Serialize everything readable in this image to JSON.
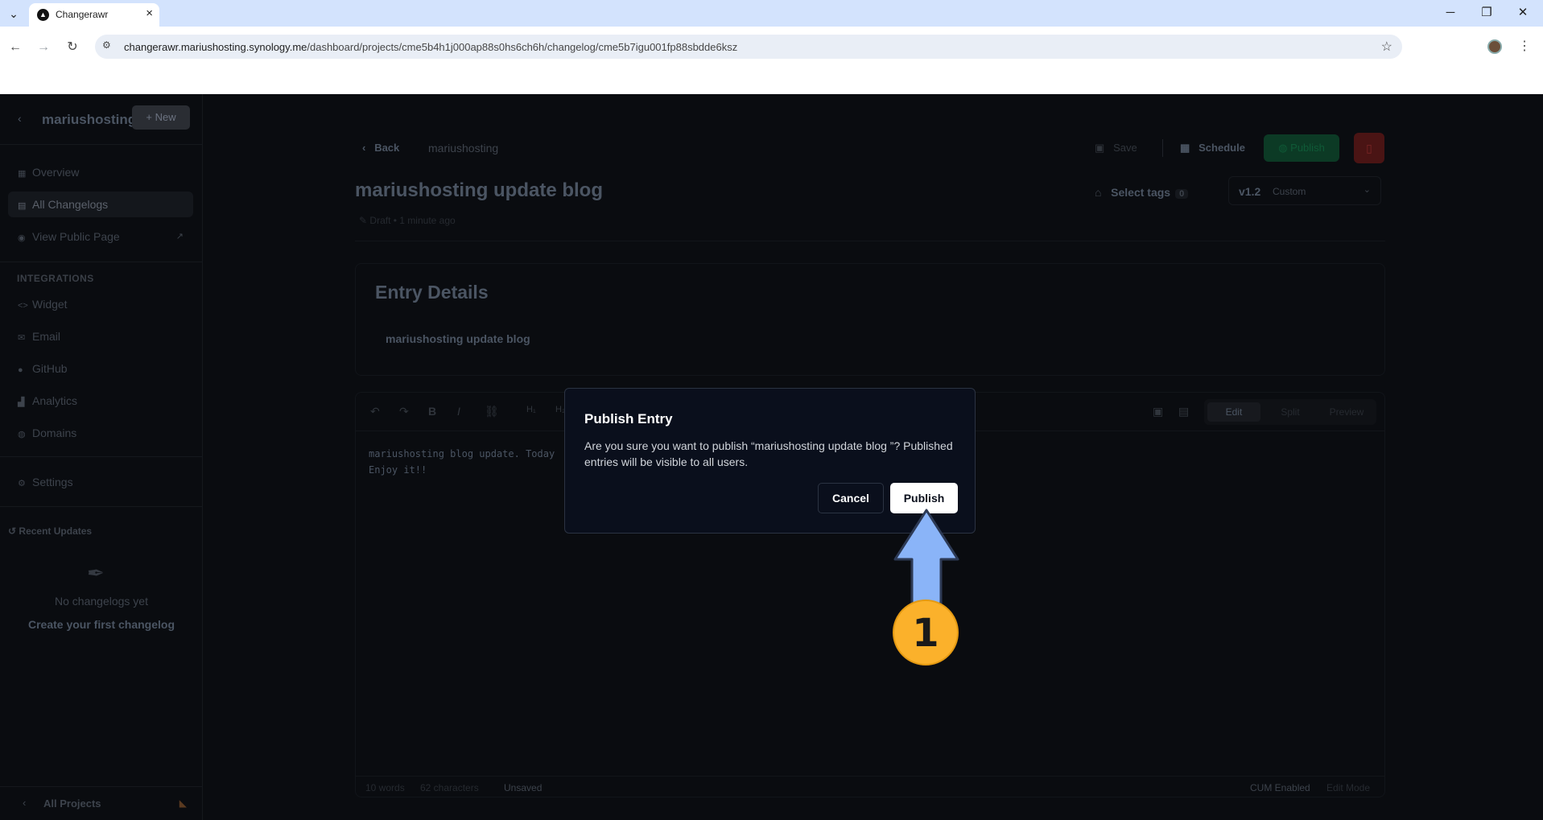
{
  "browser": {
    "tab_title": "Changerawr",
    "url_host": "changerawr.mariushosting.synology.me",
    "url_path": "/dashboard/projects/cme5b4h1j000ap88s0hs6ch6h/changelog/cme5b7igu001fp88sbdde6ksz"
  },
  "sidebar": {
    "project_name": "mariushosting",
    "new_label": "New",
    "items": [
      {
        "label": "Overview",
        "icon": "grid-icon"
      },
      {
        "label": "All Changelogs",
        "icon": "document-icon"
      },
      {
        "label": "View Public Page",
        "icon": "eye-icon"
      }
    ],
    "integrations_title": "INTEGRATIONS",
    "integrations": [
      {
        "label": "Widget",
        "icon": "code-icon"
      },
      {
        "label": "Email",
        "icon": "mail-icon"
      },
      {
        "label": "GitHub",
        "icon": "github-icon"
      },
      {
        "label": "Analytics",
        "icon": "chart-icon"
      },
      {
        "label": "Domains",
        "icon": "globe-icon"
      }
    ],
    "settings_label": "Settings",
    "recent_title": "Recent Updates",
    "empty_text": "No changelogs yet",
    "empty_cta": "Create your first changelog",
    "footer_label": "All Projects"
  },
  "editor_page": {
    "back_label": "Back",
    "breadcrumb": "mariushosting",
    "save_label": "Save",
    "schedule_label": "Schedule",
    "publish_label": "Publish",
    "title": "mariushosting update blog",
    "status": "Draft",
    "time_ago": "1 minute ago",
    "tags_label": "Select tags",
    "tags_count": "0",
    "version": "v1.2",
    "version_type": "Custom",
    "details_title": "Entry Details",
    "details_value": "mariushosting update blog",
    "modes": [
      "Edit",
      "Split",
      "Preview"
    ],
    "content_line1": "mariushosting blog update. Today",
    "content_line2": "Enjoy it!!",
    "words": "10 words",
    "chars": "62 characters",
    "save_state": "Unsaved",
    "cum": "CUM Enabled",
    "edit_mode": "Edit Mode"
  },
  "modal": {
    "title": "Publish Entry",
    "body": "Are you sure you want to publish “mariushosting update blog ”? Published entries will be visible to all users.",
    "cancel_label": "Cancel",
    "confirm_label": "Publish"
  },
  "annotation": {
    "step_number": "1",
    "arrow_color": "#8ab4f8",
    "badge_color": "#fbb12b"
  }
}
